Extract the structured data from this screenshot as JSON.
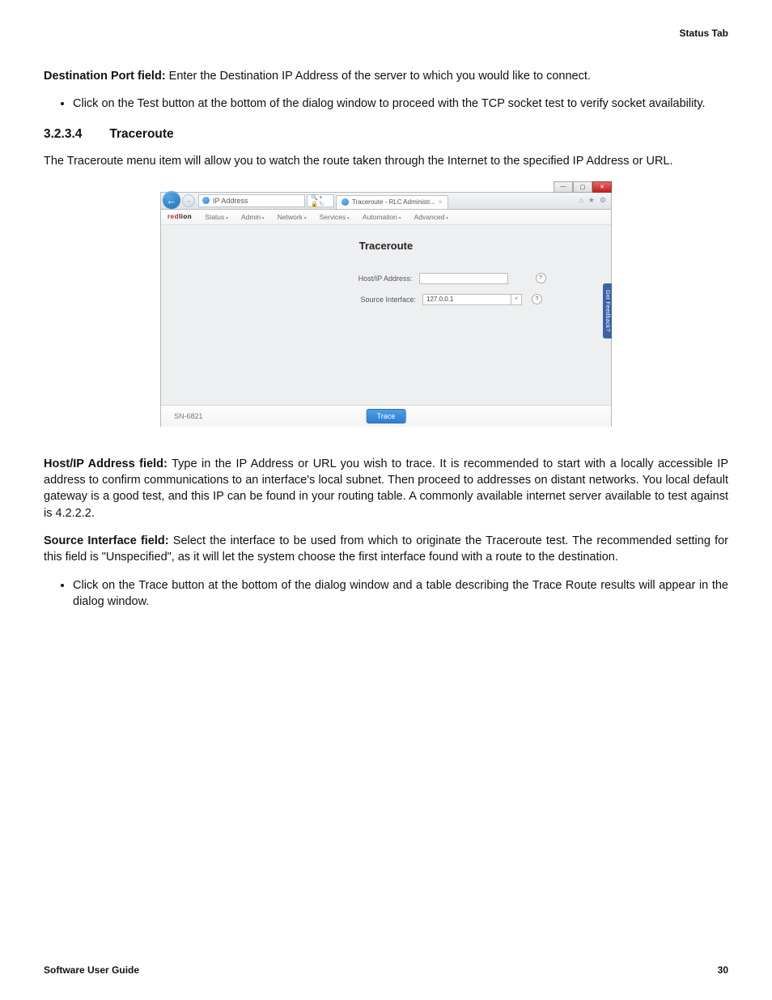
{
  "header": {
    "tab_label": "Status Tab"
  },
  "intro": {
    "dest_port_bold": "Destination Port field:",
    "dest_port_text": " Enter the Destination IP Address of the server to which you would like to connect.",
    "bullet1": "Click on the Test button at the bottom of the dialog window to proceed with the TCP socket test to verify socket availability."
  },
  "section": {
    "number": "3.2.3.4",
    "title": "Traceroute",
    "lead": "The Traceroute menu item will allow you to watch the route taken through the Internet to the specified IP Address or URL."
  },
  "browser": {
    "win_buttons": {
      "min": "—",
      "max": "▢",
      "close": "✕"
    },
    "address_label": "IP Address",
    "addr_box_right": "🔍 ▾ 🔒 ↻",
    "tab_title": "Traceroute - RLC Administr...",
    "tab_close": "×",
    "chrome_icons": {
      "home": "⌂",
      "star": "★",
      "gear": "⚙"
    }
  },
  "navbar": {
    "logo_red": "red",
    "logo_lion": "lion",
    "items": [
      "Status",
      "Admin",
      "Network",
      "Services",
      "Automation",
      "Advanced"
    ]
  },
  "content": {
    "title": "Traceroute",
    "host_label": "Host/IP Address:",
    "host_value": "",
    "src_label": "Source Interface:",
    "src_value": "127.0.0.1",
    "help_glyph": "?",
    "feedback": "Got Feedback?",
    "model": "SN-6821",
    "trace_btn": "Trace"
  },
  "after": {
    "host_bold": "Host/IP Address field:",
    "host_text": " Type in the IP Address or URL you wish to trace. It is recommended to start with a locally accessible IP address to confirm communications to an interface's local subnet. Then proceed to addresses on distant networks. You local default gateway is a good test, and this IP can be found in your routing table. A commonly available internet server available to test against is 4.2.2.2.",
    "src_bold": "Source Interface field:",
    "src_text": " Select the interface to be used from which to originate the Traceroute test. The recommended setting for this field is \"Unspecified\", as it will let the system choose the first interface found with a route to the destination.",
    "bullet2": "Click on the Trace button at the bottom of the dialog window and a table describing the Trace Route results will appear in the dialog window."
  },
  "footer": {
    "left": "Software User Guide",
    "right": "30"
  }
}
